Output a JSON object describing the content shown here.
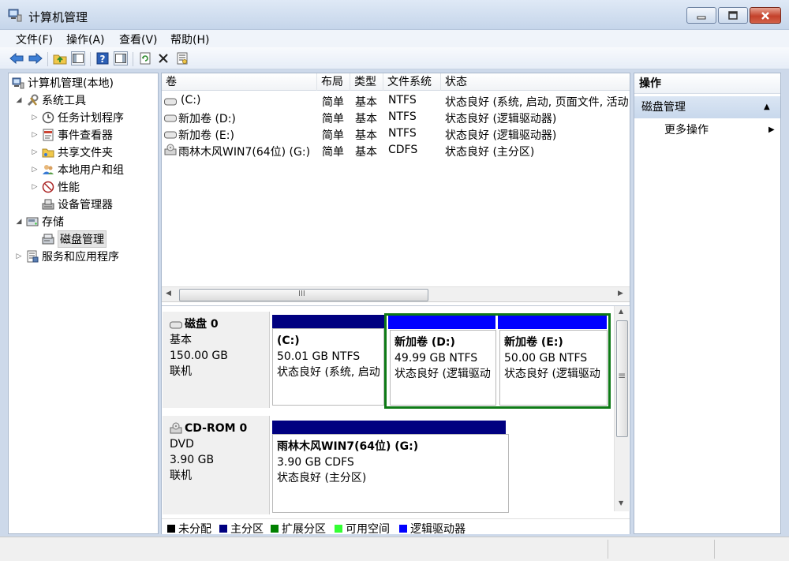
{
  "window": {
    "title": "计算机管理"
  },
  "menu": [
    "文件(F)",
    "操作(A)",
    "查看(V)",
    "帮助(H)"
  ],
  "toolbar_icons": [
    "back-arrow-icon",
    "forward-arrow-icon",
    "up-folder-icon",
    "show-hide-tree-icon",
    "help-icon",
    "properties-panel-icon",
    "refresh-icon",
    "delete-icon",
    "properties-icon"
  ],
  "tree": {
    "root": "计算机管理(本地)",
    "system_tools": "系统工具",
    "task_scheduler": "任务计划程序",
    "event_viewer": "事件查看器",
    "shared_folders": "共享文件夹",
    "local_users": "本地用户和组",
    "performance": "性能",
    "device_manager": "设备管理器",
    "storage": "存储",
    "disk_management": "磁盘管理",
    "services_apps": "服务和应用程序"
  },
  "volumes": {
    "headers": [
      "卷",
      "布局",
      "类型",
      "文件系统",
      "状态"
    ],
    "rows": [
      {
        "name": "(C:)",
        "layout": "简单",
        "type": "基本",
        "fs": "NTFS",
        "status": "状态良好 (系统, 启动, 页面文件, 活动"
      },
      {
        "name": "新加卷 (D:)",
        "layout": "简单",
        "type": "基本",
        "fs": "NTFS",
        "status": "状态良好 (逻辑驱动器)"
      },
      {
        "name": "新加卷 (E:)",
        "layout": "简单",
        "type": "基本",
        "fs": "NTFS",
        "status": "状态良好 (逻辑驱动器)"
      },
      {
        "name": "雨林木风WIN7(64位) (G:)",
        "layout": "简单",
        "type": "基本",
        "fs": "CDFS",
        "status": "状态良好 (主分区)"
      }
    ]
  },
  "disks": [
    {
      "name": "磁盘 0",
      "type": "基本",
      "size": "150.00 GB",
      "state": "联机",
      "partitions": [
        {
          "title": "(C:)",
          "size": "50.01 GB NTFS",
          "status": "状态良好 (系统, 启动"
        },
        {
          "title": "新加卷 (D:)",
          "size": "49.99 GB NTFS",
          "status": "状态良好 (逻辑驱动"
        },
        {
          "title": "新加卷 (E:)",
          "size": "50.00 GB NTFS",
          "status": "状态良好 (逻辑驱动"
        }
      ]
    },
    {
      "name": "CD-ROM 0",
      "type": "DVD",
      "size": "3.90 GB",
      "state": "联机",
      "partitions": [
        {
          "title": "雨林木风WIN7(64位) (G:)",
          "size": "3.90 GB CDFS",
          "status": "状态良好 (主分区)"
        }
      ]
    }
  ],
  "legend": [
    {
      "label": "未分配",
      "color": "#000000"
    },
    {
      "label": "主分区",
      "color": "#000080"
    },
    {
      "label": "扩展分区",
      "color": "#008000"
    },
    {
      "label": "可用空间",
      "color": "#33ff33"
    },
    {
      "label": "逻辑驱动器",
      "color": "#0000ff"
    }
  ],
  "actions": {
    "title": "操作",
    "section": "磁盘管理",
    "more": "更多操作"
  },
  "scroll_glyph": "III",
  "vscroll_glyph": "≡"
}
